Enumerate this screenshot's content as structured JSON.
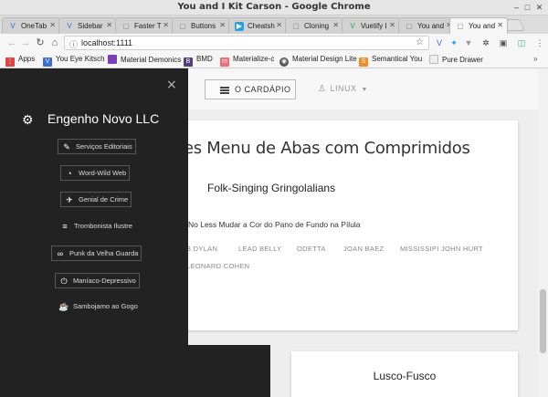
{
  "window": {
    "title": "You and I Kit Carson - Google Chrome"
  },
  "tabs": [
    {
      "label": "OneTab",
      "fav_color": "#3b6fd6",
      "fav": "V"
    },
    {
      "label": "Sidebar",
      "fav_color": "#3b6fd6",
      "fav": "V"
    },
    {
      "label": "Faster T",
      "fav_color": "#ffffff",
      "fav": "▢"
    },
    {
      "label": "Buttons",
      "fav_color": "#ffffff",
      "fav": "▢"
    },
    {
      "label": "Cheatsh",
      "fav_color": "#2aa0d8",
      "fav": "▶"
    },
    {
      "label": "Cloning",
      "fav_color": "#ffffff",
      "fav": "▢"
    },
    {
      "label": "Vuetify I",
      "fav_color": "#2e9e5b",
      "fav": "V"
    },
    {
      "label": "You and",
      "fav_color": "#ffffff",
      "fav": "▢"
    },
    {
      "label": "You and",
      "fav_color": "#ffffff",
      "fav": "▢",
      "active": true
    }
  ],
  "toolbar": {
    "url": "localhost:1111"
  },
  "bookmarks": [
    {
      "label": "Apps",
      "color": "#d44"
    },
    {
      "label": "You Eye Kitsch",
      "color": "#3b6fd6"
    },
    {
      "label": "Material Demonics",
      "color": "#7b3fb8"
    },
    {
      "label": "BMD",
      "color": "#563d7c"
    },
    {
      "label": "Materialize-c",
      "color": "#ee6e73"
    },
    {
      "label": "Material Design Lite",
      "color": "#555"
    },
    {
      "label": "Semantical You",
      "color": "#f28c28"
    },
    {
      "label": "Pure Drawer",
      "color": "#eee"
    }
  ],
  "header": {
    "menu_label": "O CARDÁPIO",
    "os_label": "LINUX"
  },
  "card1": {
    "title": "es Menu de Abas com Comprimidos",
    "subtitle": "Folk-Singing Gringolalians",
    "description": "No Less Mudar a Cor do Pano de Fundo na Pílula",
    "chips": [
      "B DYLAN",
      "LEAD BELLY",
      "ODETTA",
      "JOAN BAEZ",
      "MISSISSIPI JOHN HURT",
      "LEONARD COHEN"
    ]
  },
  "card2": {
    "title": "Lusco-Fusco"
  },
  "drawer": {
    "brand": "Engenho Novo LLC",
    "items": [
      {
        "label": "Serviços Editoriais",
        "icon": "pencil-icon",
        "glyph": "✎"
      },
      {
        "label": "Word-Wild Web",
        "icon": "satellite-dish-icon",
        "glyph": "◔"
      },
      {
        "label": "Genial de Crime",
        "icon": "airplane-icon",
        "glyph": "✈"
      },
      {
        "label": "Trombonista Ilustre",
        "icon": "playlist-icon",
        "glyph": "≡"
      },
      {
        "label": "Punk da Velha Guarda",
        "icon": "infinity-icon",
        "glyph": "∞"
      },
      {
        "label": "Maníaco-Depressivo",
        "icon": "power-icon",
        "glyph": "⏻"
      },
      {
        "label": "Sambojamo ao Gogo",
        "icon": "coffee-cup-icon",
        "glyph": "☕"
      }
    ]
  }
}
